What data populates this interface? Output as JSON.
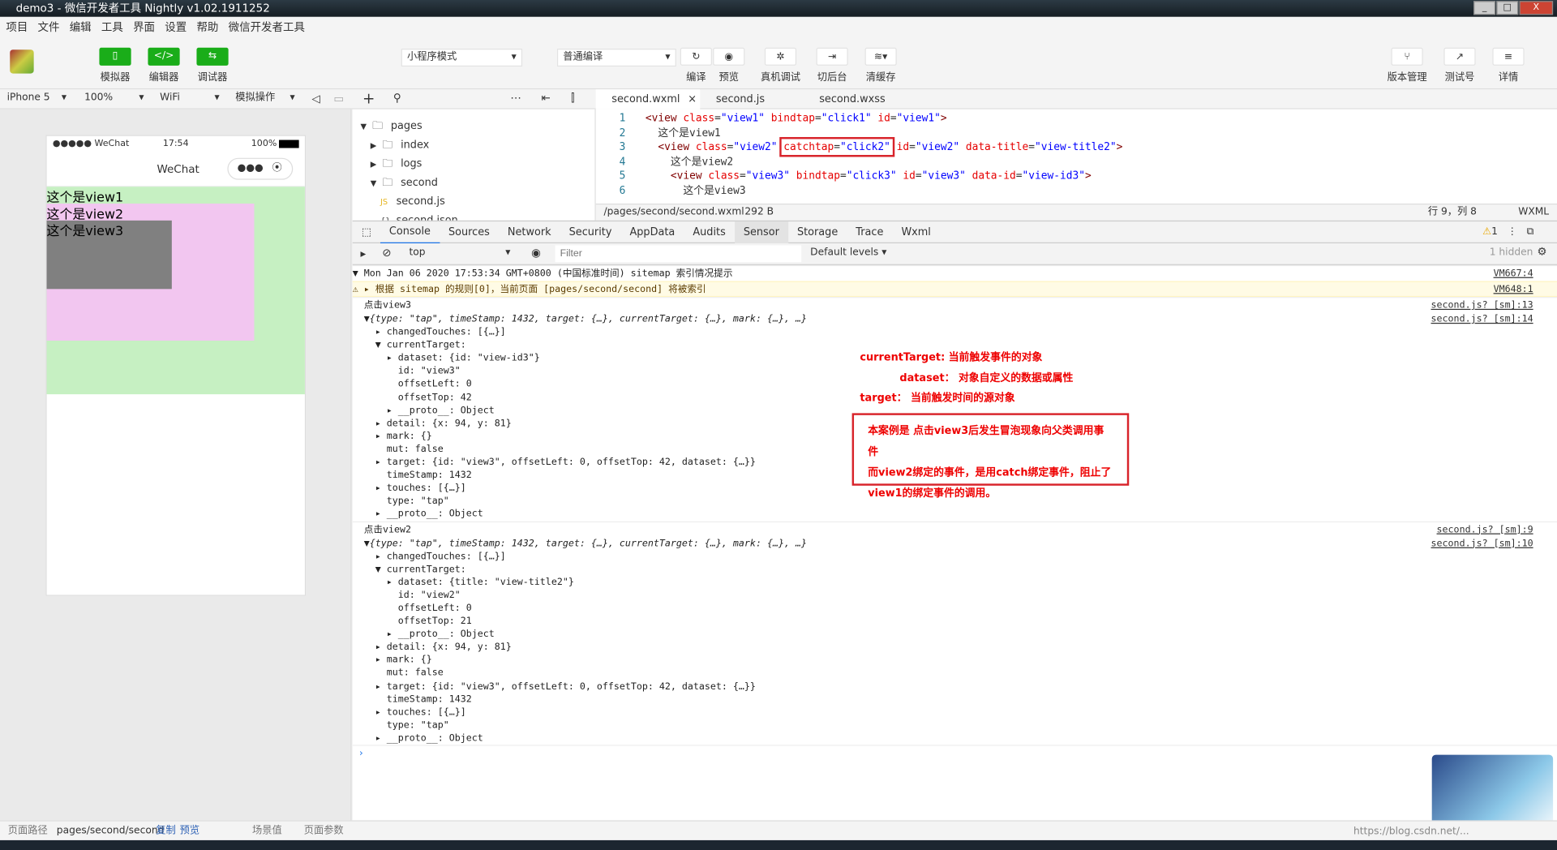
{
  "window": {
    "title": "demo3 - 微信开发者工具 Nightly v1.02.1911252"
  },
  "menu": [
    "项目",
    "文件",
    "编辑",
    "工具",
    "界面",
    "设置",
    "帮助",
    "微信开发者工具"
  ],
  "toolbar": {
    "simulator": "模拟器",
    "editor": "编辑器",
    "debugger": "调试器",
    "mode": "小程序模式",
    "compile_mode": "普通编译",
    "compile": "编译",
    "preview": "预览",
    "real_debug": "真机调试",
    "background": "切后台",
    "clear_cache": "清缓存",
    "version": "版本管理",
    "test": "测试号",
    "details": "详情"
  },
  "sim_bar": {
    "device": "iPhone 5",
    "zoom": "100%",
    "network": "WiFi",
    "operation": "模拟操作"
  },
  "phone": {
    "carrier": "●●●●● WeChat",
    "time": "17:54",
    "battery": "100%",
    "nav_title": "WeChat",
    "view1": "这个是view1",
    "view2": "这个是view2",
    "view3": "这个是view3",
    "colors": {
      "view1": "#c6f0c2",
      "view2": "#f2c6f0",
      "view3": "#808080"
    }
  },
  "tree": [
    {
      "label": "pages",
      "open": true,
      "level": 0
    },
    {
      "label": "index",
      "level": 1
    },
    {
      "label": "logs",
      "level": 1
    },
    {
      "label": "second",
      "open": true,
      "level": 1
    },
    {
      "label": "second.js",
      "level": 2,
      "file": "JS"
    },
    {
      "label": "second.json",
      "level": 2,
      "file": "{}"
    }
  ],
  "editor": {
    "tabs": [
      "second.wxml",
      "second.js",
      "second.wxss"
    ],
    "path": "/pages/second/second.wxml",
    "size": "292 B",
    "cursor": "行 9，列 8",
    "lang": "WXML",
    "lines": [
      {
        "n": "1",
        "html": "<span class='t'>&lt;view</span> <span class='a'>class</span>=<span class='v'>\"view1\"</span> <span class='a'>bindtap</span>=<span class='v'>\"click1\"</span> <span class='a'>id</span>=<span class='v'>\"view1\"</span><span class='t'>&gt;</span>"
      },
      {
        "n": "2",
        "html": "  这个是view1"
      },
      {
        "n": "3",
        "html": "  <span class='t'>&lt;view</span> <span class='a'>class</span>=<span class='v'>\"view2\"</span> <span style='outline:2px solid #d8232a;outline-offset:2px'><span class='a'>catchtap</span>=<span class='v'>\"click2\"</span></span> <span class='a'>id</span>=<span class='v'>\"view2\"</span> <span class='a'>data-title</span>=<span class='v'>\"view-title2\"</span><span class='t'>&gt;</span>"
      },
      {
        "n": "4",
        "html": "    这个是view2"
      },
      {
        "n": "5",
        "html": "    <span class='t'>&lt;view</span> <span class='a'>class</span>=<span class='v'>\"view3\"</span> <span class='a'>bindtap</span>=<span class='v'>\"click3\"</span> <span class='a'>id</span>=<span class='v'>\"view3\"</span> <span class='a'>data-id</span>=<span class='v'>\"view-id3\"</span><span class='t'>&gt;</span>"
      },
      {
        "n": "6",
        "html": "      这个是view3"
      }
    ]
  },
  "devtools": {
    "tabs": [
      "Console",
      "Sources",
      "Network",
      "Security",
      "AppData",
      "Audits",
      "Sensor",
      "Storage",
      "Trace",
      "Wxml"
    ],
    "warn_count": "1",
    "context": "top",
    "filter_placeholder": "Filter",
    "levels": "Default levels ▾",
    "hidden": "1 hidden"
  },
  "console": [
    {
      "cls": "hd",
      "text": "▼ Mon Jan 06 2020 17:53:34 GMT+0800 (中国标准时间) sitemap 索引情况提示",
      "link": "VM667:4"
    },
    {
      "cls": "warn",
      "text": "⚠ ▸ 根据 sitemap 的规则[0]，当前页面 [pages/second/second] 将被索引",
      "link": "VM648:1"
    },
    {
      "cls": "hd",
      "text": "  点击view3",
      "link": "second.js? [sm]:13"
    },
    {
      "text": "  ▼{type: \"tap\", timeStamp: 1432, target: {…}, currentTarget: {…}, mark: {…}, …}",
      "link": "second.js? [sm]:14",
      "it": true
    },
    {
      "text": "    ▸ changedTouches: [{…}]"
    },
    {
      "text": "    ▼ currentTarget:"
    },
    {
      "text": "      ▸ dataset: {id: \"view-id3\"}"
    },
    {
      "text": "        id: \"view3\""
    },
    {
      "text": "        offsetLeft: 0"
    },
    {
      "text": "        offsetTop: 42"
    },
    {
      "text": "      ▸ __proto__: Object"
    },
    {
      "text": "    ▸ detail: {x: 94, y: 81}"
    },
    {
      "text": "    ▸ mark: {}"
    },
    {
      "text": "      mut: false"
    },
    {
      "text": "    ▸ target: {id: \"view3\", offsetLeft: 0, offsetTop: 42, dataset: {…}}"
    },
    {
      "text": "      timeStamp: 1432"
    },
    {
      "text": "    ▸ touches: [{…}]"
    },
    {
      "text": "      type: \"tap\""
    },
    {
      "text": "    ▸ __proto__: Object"
    },
    {
      "cls": "hd",
      "text": "  点击view2",
      "link": "second.js? [sm]:9"
    },
    {
      "text": "  ▼{type: \"tap\", timeStamp: 1432, target: {…}, currentTarget: {…}, mark: {…}, …}",
      "link": "second.js? [sm]:10",
      "it": true
    },
    {
      "text": "    ▸ changedTouches: [{…}]"
    },
    {
      "text": "    ▼ currentTarget:"
    },
    {
      "text": "      ▸ dataset: {title: \"view-title2\"}"
    },
    {
      "text": "        id: \"view2\""
    },
    {
      "text": "        offsetLeft: 0"
    },
    {
      "text": "        offsetTop: 21"
    },
    {
      "text": "      ▸ __proto__: Object"
    },
    {
      "text": "    ▸ detail: {x: 94, y: 81}"
    },
    {
      "text": "    ▸ mark: {}"
    },
    {
      "text": "      mut: false"
    },
    {
      "text": "    ▸ target: {id: \"view3\", offsetLeft: 0, offsetTop: 42, dataset: {…}}"
    },
    {
      "text": "      timeStamp: 1432"
    },
    {
      "text": "    ▸ touches: [{…}]"
    },
    {
      "text": "      type: \"tap\""
    },
    {
      "text": "    ▸ __proto__: Object"
    },
    {
      "cls": "hd",
      "text": " ›"
    }
  ],
  "annotations": {
    "current_target": "currentTarget: 当前触发事件的对象",
    "dataset": "dataset： 对象自定义的数据或属性",
    "target": "target： 当前触发时间的源对象",
    "box": [
      "本案例是 点击view3后发生冒泡现象向父类调用事件",
      "而view2绑定的事件，是用catch绑定事件，阻止了",
      "view1的绑定事件的调用。"
    ]
  },
  "statusbar": {
    "path_label": "页面路径",
    "path": "pages/second/second",
    "copy": "复制",
    "preview": "预览",
    "scene": "场景值",
    "params": "页面参数"
  },
  "watermark": "https://blog.csdn.net/..."
}
